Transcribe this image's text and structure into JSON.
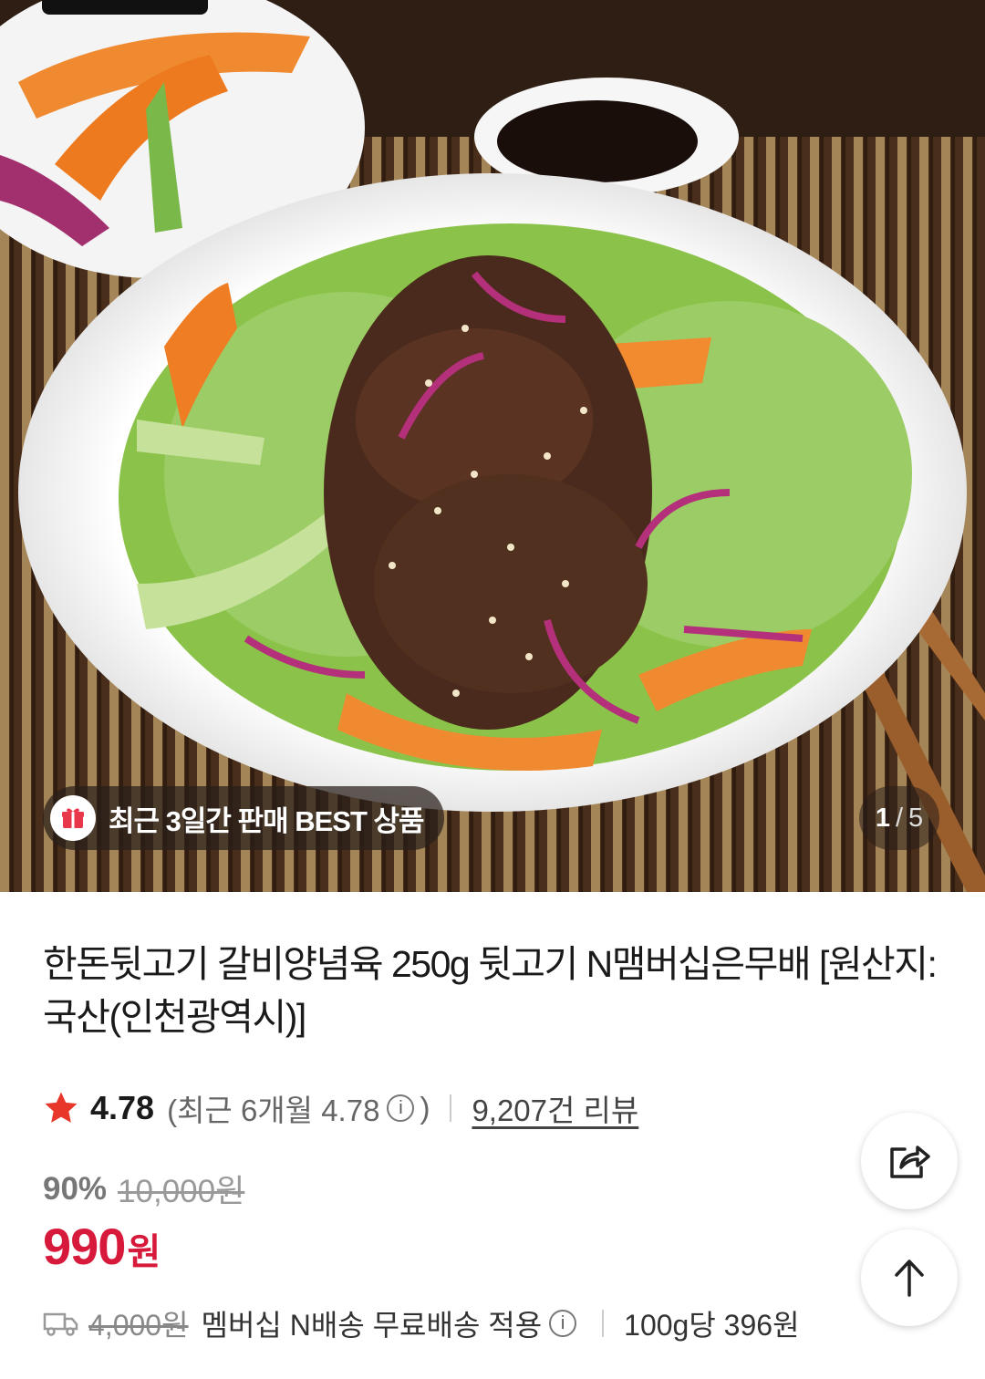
{
  "hero": {
    "badge_text": "최근 3일간 판매 BEST 상품",
    "counter_current": "1",
    "counter_separator": "/",
    "counter_total": "5"
  },
  "product": {
    "title": "한돈뒷고기 갈비양념육 250g 뒷고기 N맴버십은무배 [원산지:국산(인천광역시)]",
    "rating": "4.78",
    "recent_rating_prefix": "(최근 6개월 4.78",
    "recent_rating_suffix": ")",
    "review_count": "9,207건 리뷰",
    "discount_rate": "90%",
    "original_price": "10,000원",
    "sale_price": "990",
    "currency": "원"
  },
  "shipping": {
    "original_fee": "4,000원",
    "description": "멤버십 N배송 무료배송 적용",
    "unit_price": "100g당 396원"
  },
  "icons": {
    "badge": "gift-icon",
    "rating": "star-icon",
    "info": "info-icon",
    "shipping": "truck-icon",
    "share": "share-icon",
    "top": "arrow-up-icon"
  },
  "colors": {
    "accent_red": "#d71a3b",
    "star": "#e8362a"
  }
}
